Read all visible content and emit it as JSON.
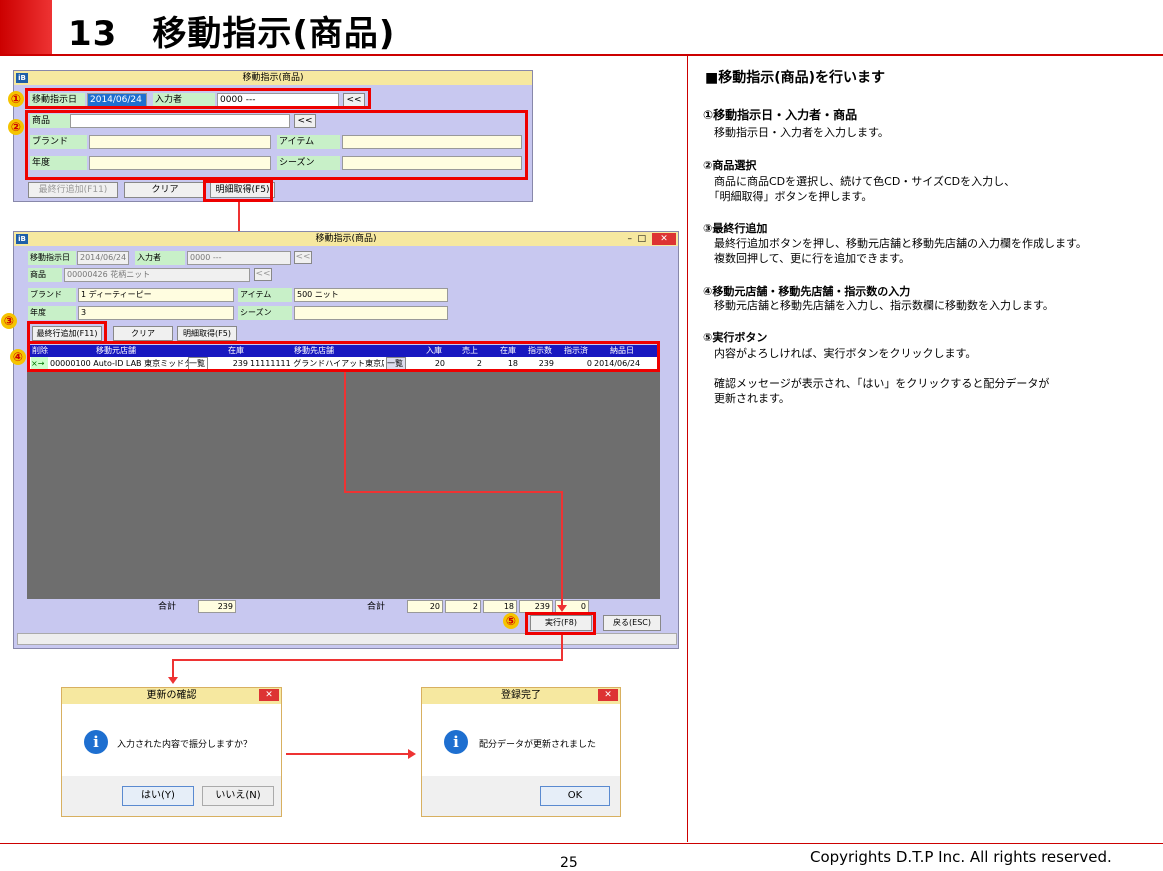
{
  "slide": {
    "title": "13　移動指示(商品)",
    "page_number": "25",
    "copyright": "Copyrights  D.T.P Inc. All rights reserved."
  },
  "win1": {
    "title": "移動指示(商品)",
    "icon": "iB",
    "date_label": "移動指示日",
    "date_value": "2014/06/24",
    "inputter_label": "入力者",
    "inputter_value": "0000 ---",
    "product_label": "商品",
    "brand_label": "ブランド",
    "item_label": "アイテム",
    "year_label": "年度",
    "season_label": "シーズン",
    "back_btn": "<<",
    "btn_add_row": "最終行追加(F11)",
    "btn_clear": "クリア",
    "btn_detail": "明細取得(F5)"
  },
  "win2": {
    "title": "移動指示(商品)",
    "icon": "iB",
    "date_label": "移動指示日",
    "date_value": "2014/06/24",
    "inputter_label": "入力者",
    "inputter_value": "0000 ---",
    "product_label": "商品",
    "product_value": "00000426 花柄ニット",
    "brand_label": "ブランド",
    "brand_value": "1 ディーティーピー",
    "item_label": "アイテム",
    "item_value": "500 ニット",
    "year_label": "年度",
    "year_value": "3",
    "season_label": "シーズン",
    "back_btn": "<<",
    "btn_add_row": "最終行追加(F11)",
    "btn_clear": "クリア",
    "btn_detail": "明細取得(F5)",
    "columns": [
      "削除",
      "移動元店舗",
      "在庫",
      "移動先店舗",
      "入庫",
      "売上",
      "在庫",
      "指示数",
      "指示済",
      "納品日"
    ],
    "row": {
      "del": "×→",
      "from_store": "00000100 Auto-ID LAB 東京ミッドタ",
      "list1": "一覧",
      "stock": "239",
      "to_store": "11111111 グランドハイアット東京店",
      "list2": "一覧",
      "in": "20",
      "sales": "2",
      "stock2": "18",
      "qty": "239",
      "done": "0",
      "date": "2014/06/24"
    },
    "total_label": "合計",
    "total_stock": "239",
    "total2_label": "合計",
    "total_in": "20",
    "total_sales": "2",
    "total_stock2": "18",
    "total_qty": "239",
    "total_done": "0",
    "btn_exec": "実行(F8)",
    "btn_back": "戻る(ESC)"
  },
  "dialog_confirm": {
    "title": "更新の確認",
    "message": "入力された内容で振分しますか？",
    "btn_yes": "はい(Y)",
    "btn_no": "いいえ(N)"
  },
  "dialog_done": {
    "title": "登録完了",
    "message": "配分データが更新されました",
    "btn_ok": "OK"
  },
  "badges": [
    "①",
    "②",
    "③",
    "④",
    "⑤"
  ],
  "right": {
    "heading": "■移動指示(商品)を行います",
    "s1_title": "①移動指示日・入力者・商品",
    "s1_body": "　移動指示日・入力者を入力します。",
    "s2_title": "②商品選択",
    "s2_body": "　商品に商品CDを選択し、続けて色CD・サイズCDを入力し、\n　「明細取得」ボタンを押します。",
    "s3_title": "③最終行追加",
    "s3_body": "　最終行追加ボタンを押し、移動元店舗と移動先店舗の入力欄を作成します。\n　複数回押して、更に行を追加できます。",
    "s4_title": "④移動元店舗・移動先店舗・指示数の入力",
    "s4_body": "　移動元店舗と移動先店舗を入力し、指示数欄に移動数を入力します。",
    "s5_title": "⑤実行ボタン",
    "s5_body": "　内容がよろしければ、実行ボタンをクリックします。\n\n　確認メッセージが表示され、「はい」をクリックすると配分データが\n　更新されます。"
  }
}
